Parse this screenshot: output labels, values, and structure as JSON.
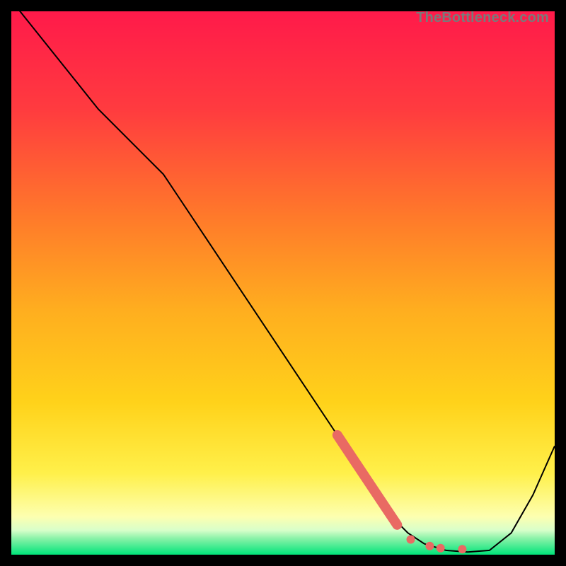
{
  "watermark": "TheBottleneck.com",
  "chart_data": {
    "type": "line",
    "title": "",
    "xlabel": "",
    "ylabel": "",
    "xlim": [
      0,
      100
    ],
    "ylim": [
      0,
      100
    ],
    "grid": false,
    "legend": false,
    "gradient": {
      "top_color": "#ff1a4a",
      "mid_color": "#ffd400",
      "bottom_band_color": "#00e47a",
      "bottom_band_start": 96,
      "bottom_band_end": 100
    },
    "series": [
      {
        "name": "curve",
        "color": "#000000",
        "stroke_width": 2,
        "x": [
          0,
          8,
          16,
          24,
          28,
          36,
          44,
          52,
          60,
          67,
          70,
          73,
          76,
          80,
          84,
          88,
          92,
          96,
          100
        ],
        "y": [
          102,
          92,
          82,
          74,
          70,
          58,
          46,
          34,
          22,
          11,
          7,
          4,
          2,
          0.8,
          0.5,
          0.8,
          4,
          11,
          20
        ]
      }
    ],
    "highlight_segment": {
      "comment": "thick salmon overlay on descending tail",
      "color": "#e96a63",
      "stroke_width": 14,
      "x": [
        60,
        63,
        66,
        69,
        71
      ],
      "y": [
        22,
        17.5,
        13,
        8.5,
        5.5
      ]
    },
    "dots": {
      "comment": "dotted salmon markers near valley",
      "color": "#e96a63",
      "radius": 6,
      "points": [
        {
          "x": 73.5,
          "y": 2.8
        },
        {
          "x": 77,
          "y": 1.6
        },
        {
          "x": 79,
          "y": 1.2
        },
        {
          "x": 83,
          "y": 1.0
        }
      ]
    }
  }
}
